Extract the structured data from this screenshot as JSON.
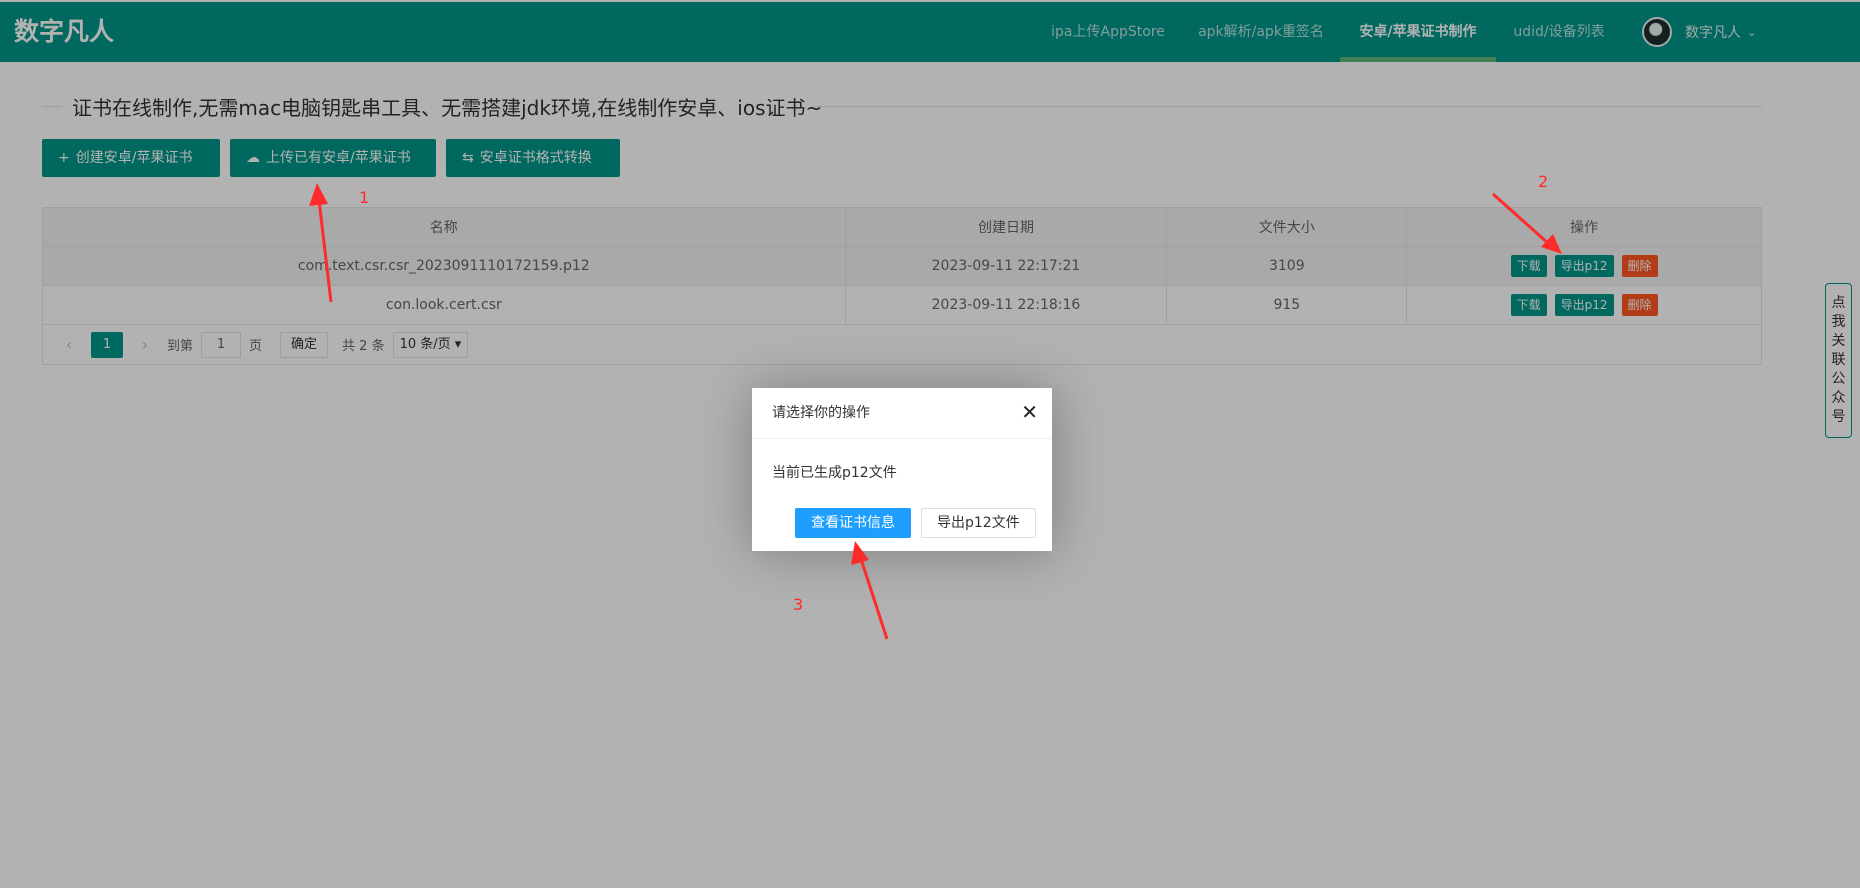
{
  "app": {
    "logo": "数字凡人"
  },
  "nav": {
    "items": [
      {
        "label": "ipa上传AppStore"
      },
      {
        "label": "apk解析/apk重签名"
      },
      {
        "label": "安卓/苹果证书制作",
        "active": true
      },
      {
        "label": "udid/设备列表"
      }
    ],
    "user": "数字凡人"
  },
  "page": {
    "legend": "证书在线制作,无需mac电脑钥匙串工具、无需搭建jdk环境,在线制作安卓、ios证书~",
    "buttons": {
      "create": "创建安卓/苹果证书",
      "upload": "上传已有安卓/苹果证书",
      "convert": "安卓证书格式转换"
    }
  },
  "table": {
    "headers": [
      "名称",
      "创建日期",
      "文件大小",
      "操作"
    ],
    "rows": [
      {
        "name": "com.text.csr.csr_2023091110172159.p12",
        "date": "2023-09-11 22:17:21",
        "size": "3109"
      },
      {
        "name": "con.look.cert.csr",
        "date": "2023-09-11 22:18:16",
        "size": "915"
      }
    ],
    "actions": {
      "download": "下载",
      "export": "导出p12",
      "delete": "删除"
    }
  },
  "pager": {
    "current": "1",
    "goto_label": "到第",
    "goto_value": "1",
    "page_unit": "页",
    "confirm": "确定",
    "total": "共 2 条",
    "page_size": "10 条/页"
  },
  "side_tab": {
    "label": "点我关联公众号"
  },
  "modal": {
    "title": "请选择你的操作",
    "message": "当前已生成p12文件",
    "primary": "查看证书信息",
    "secondary": "导出p12文件"
  },
  "annotations": [
    "1",
    "2",
    "3"
  ],
  "colors": {
    "brand": "#009688",
    "nav_active_bar": "#5FB878",
    "danger": "#FF5722",
    "modal_primary": "#1E9FFF",
    "annotation": "#ff2b2b"
  },
  "icons": [
    "plus-icon",
    "cloud-upload-icon",
    "convert-icon",
    "chevron-down-icon",
    "close-icon",
    "prev-icon",
    "next-icon"
  ]
}
